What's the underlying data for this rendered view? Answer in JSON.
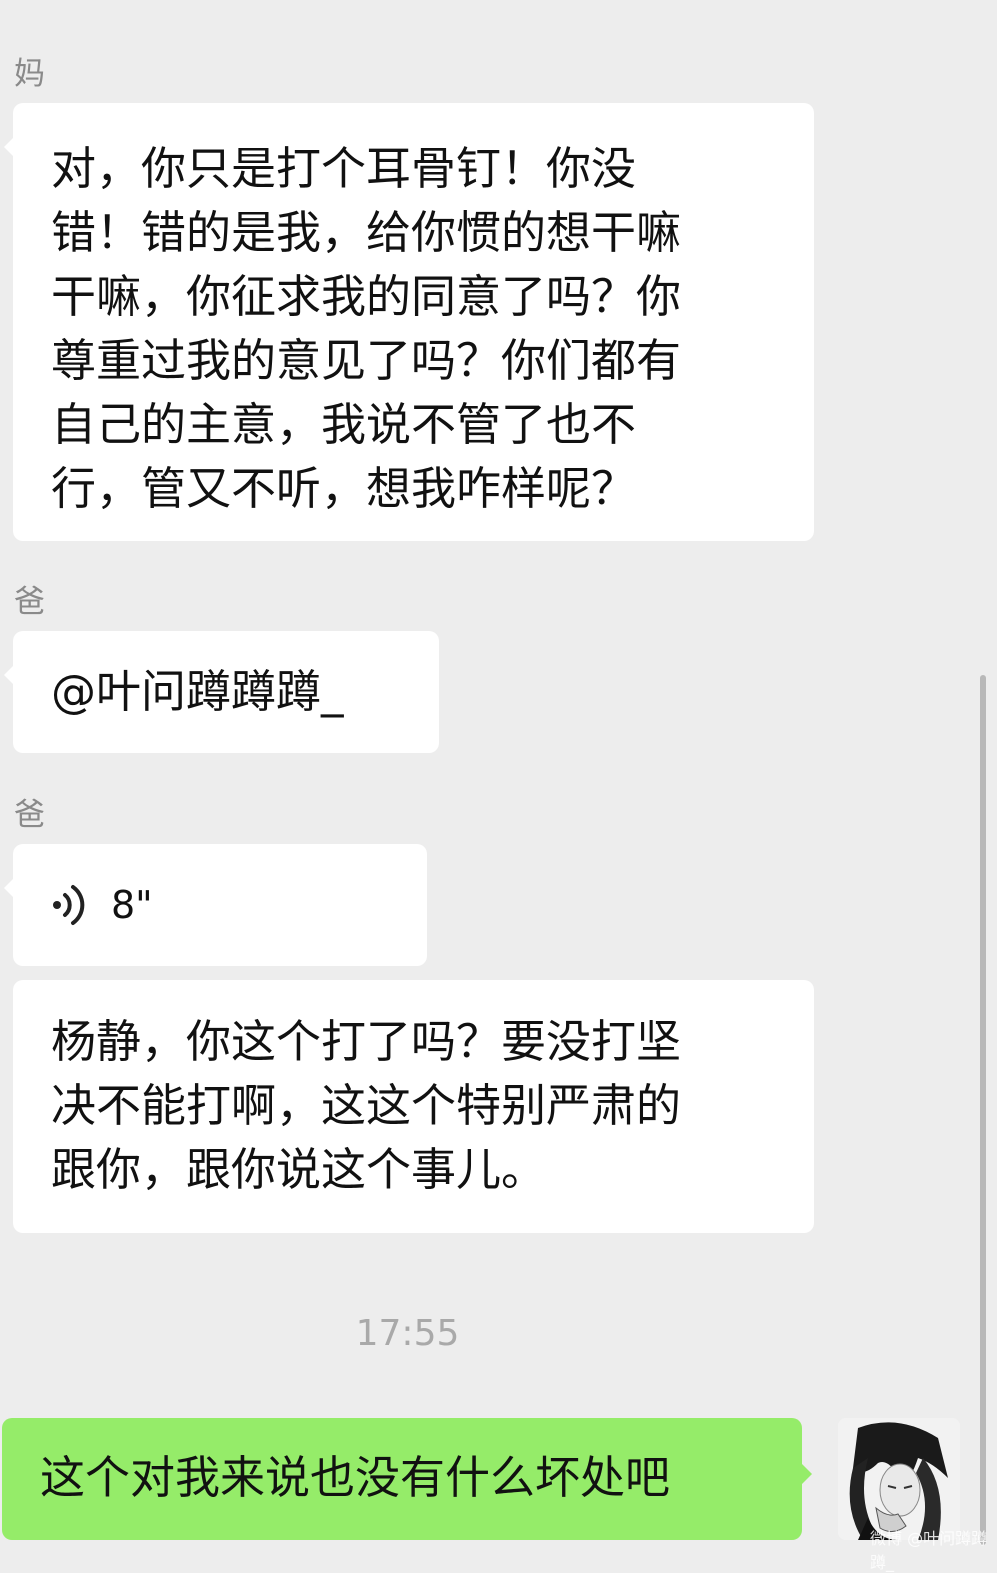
{
  "messages": [
    {
      "sender": "妈",
      "type": "text",
      "lines": [
        "对，你只是打个耳骨钉！你没",
        "错！错的是我，给你惯的想干嘛",
        "干嘛，你征求我的同意了吗？你",
        "尊重过我的意见了吗？你们都有",
        "自己的主意，我说不管了也不",
        "行，管又不听，想我咋样呢？"
      ]
    },
    {
      "sender": "爸",
      "type": "text",
      "lines": [
        "@叶问蹲蹲蹲_"
      ]
    },
    {
      "sender": "爸",
      "type": "voice",
      "duration": "8\""
    },
    {
      "type": "text",
      "lines": [
        "杨静，你这个打了吗？要没打坚",
        "决不能打啊，这这个特别严肃的",
        "跟你，跟你说这个事儿。"
      ]
    }
  ],
  "timestamp": "17:55",
  "outgoing": {
    "lines": [
      "这个对我来说也没有什么坏处吧"
    ]
  },
  "avatar_icon": "user-avatar",
  "watermark": "微博 @叶问蹲蹲蹲_"
}
